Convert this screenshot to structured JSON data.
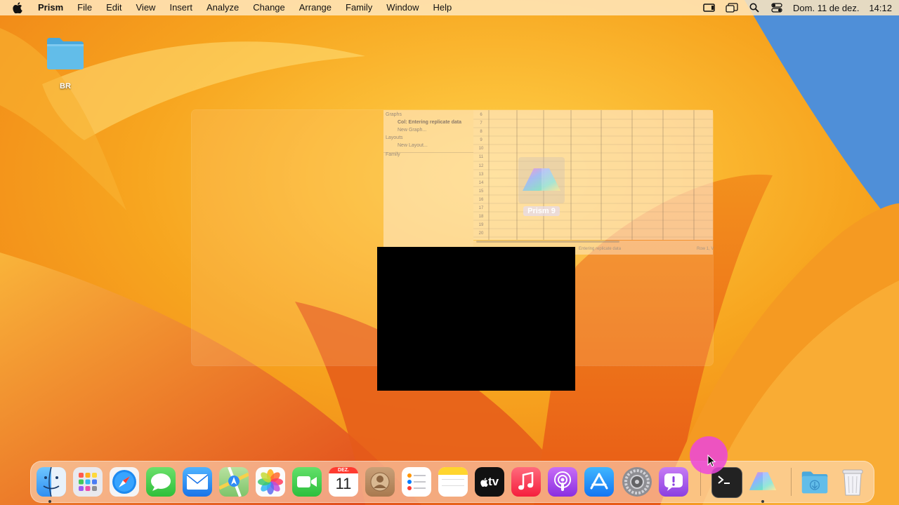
{
  "menubar": {
    "app_name": "Prism",
    "menus": [
      "File",
      "Edit",
      "View",
      "Insert",
      "Analyze",
      "Change",
      "Arrange",
      "Family",
      "Window",
      "Help"
    ],
    "date": "Dom. 11 de dez.",
    "time": "14:12",
    "status_icons": [
      "screen-mirroring-icon",
      "stage-manager-icon",
      "search-icon",
      "control-center-icon"
    ]
  },
  "desktop": {
    "folder_label": "BR"
  },
  "ghost_window": {
    "nav": {
      "graphs_header": "Graphs",
      "graph_item": "Col: Entering replicate data",
      "new_graph": "New Graph...",
      "layouts_header": "Layouts",
      "new_layout": "New Layout...",
      "family_header": "Family"
    },
    "row_numbers": [
      "6",
      "7",
      "8",
      "9",
      "10",
      "11",
      "12",
      "13",
      "14",
      "15",
      "16",
      "17",
      "18",
      "19",
      "20"
    ],
    "status_text": "Entering replicate data",
    "status_right": "Row 1, V"
  },
  "drag_item": {
    "label": "Prism 9"
  },
  "dock": {
    "calendar_month": "DEZ.",
    "calendar_day": "11",
    "tv_label": "tv",
    "items": [
      "Finder",
      "Launchpad",
      "Safari",
      "Messages",
      "Mail",
      "Maps",
      "Photos",
      "FaceTime",
      "Calendar",
      "Contacts",
      "Reminders",
      "Notes",
      "TV",
      "Music",
      "Podcasts",
      "App Store",
      "System Settings",
      "Feedback Assistant",
      "Terminal",
      "Prism",
      "Downloads",
      "Trash"
    ]
  },
  "colors": {
    "wallpaper_base": "#f5a21e",
    "wallpaper_deep": "#e8501a",
    "wallpaper_blue": "#4a8fd6"
  }
}
